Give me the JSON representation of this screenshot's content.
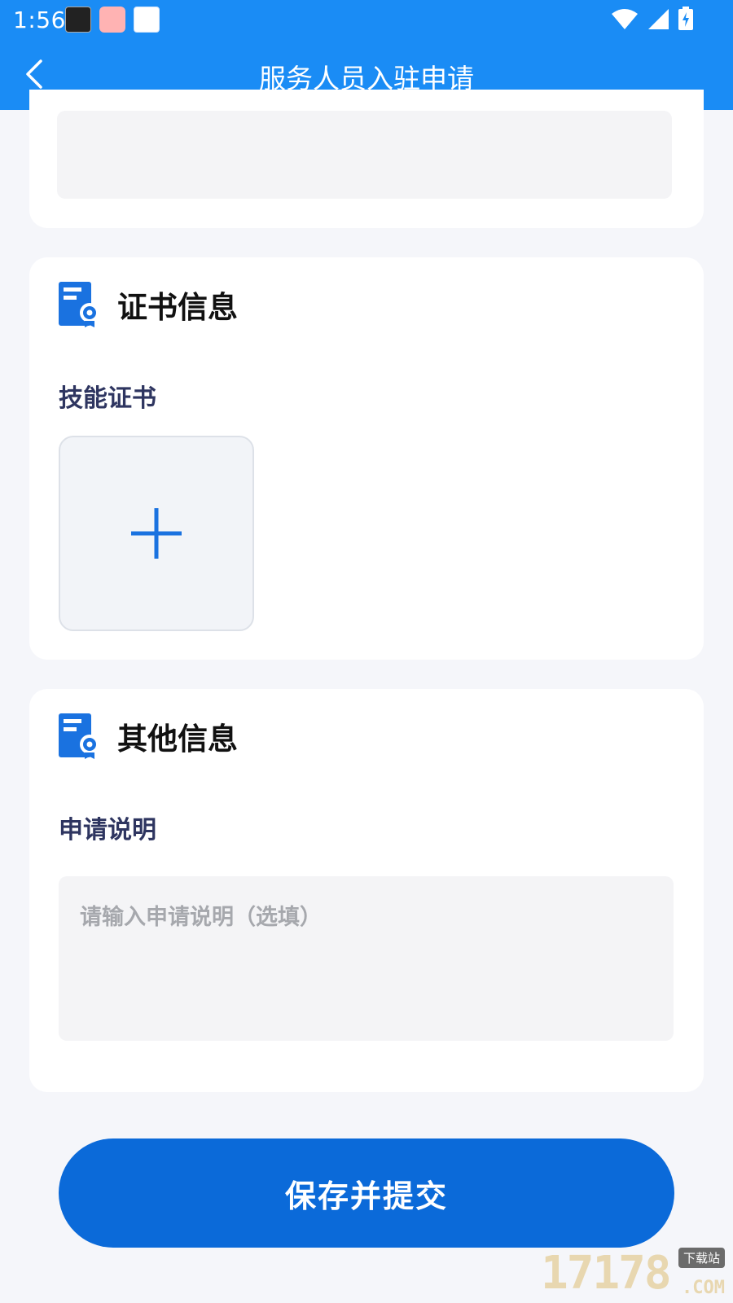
{
  "status_bar": {
    "time": "1:56"
  },
  "header": {
    "title": "服务人员入驻申请"
  },
  "cert_section": {
    "title": "证书信息",
    "skill_label": "技能证书"
  },
  "other_section": {
    "title": "其他信息",
    "description_label": "申请说明",
    "description_placeholder": "请输入申请说明（选填）",
    "description_value": ""
  },
  "submit": {
    "label": "保存并提交"
  },
  "watermark": {
    "number": "17178",
    "tag": "下载站",
    "suffix": ".COM"
  },
  "colors": {
    "primary": "#1a8cf5",
    "button": "#0b6ad9",
    "label": "#2e3560"
  }
}
